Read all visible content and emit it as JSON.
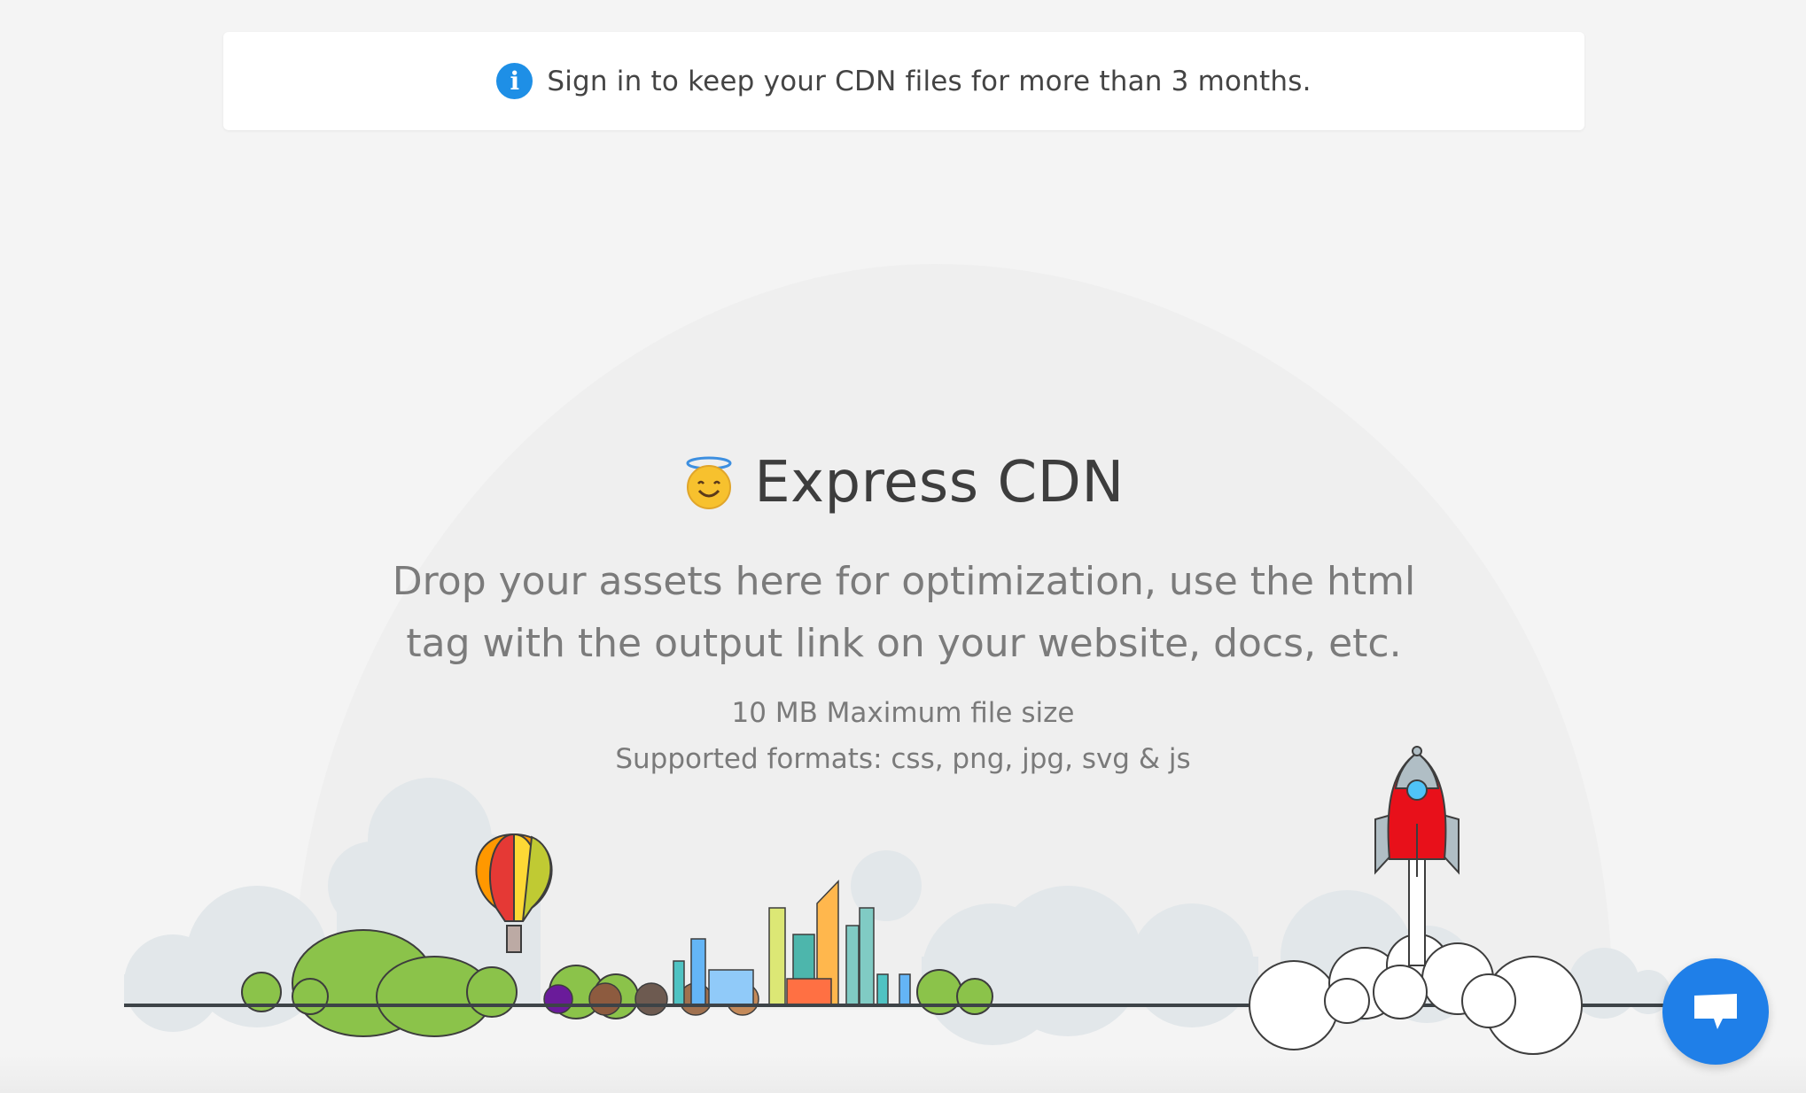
{
  "notice": {
    "icon": "info-icon",
    "text": "Sign in to keep your CDN files for more than 3 months."
  },
  "hero": {
    "emoji": "😇",
    "title": "Express CDN",
    "description": "Drop your assets here for optimization, use the html tag with the output link on your website, docs, etc.",
    "max_size": "10 MB Maximum file size",
    "formats": "Supported formats: css, png, jpg, svg & js"
  },
  "illustration": {
    "items": [
      "hot-air-balloon",
      "trees",
      "city-skyline",
      "rocket",
      "clouds"
    ]
  },
  "chat": {
    "icon": "chat-bubble-icon"
  },
  "colors": {
    "accent": "#1e8fe6",
    "chat": "#1f7fe8",
    "rocket_red": "#e8101a",
    "tree_green": "#8bc34a"
  }
}
